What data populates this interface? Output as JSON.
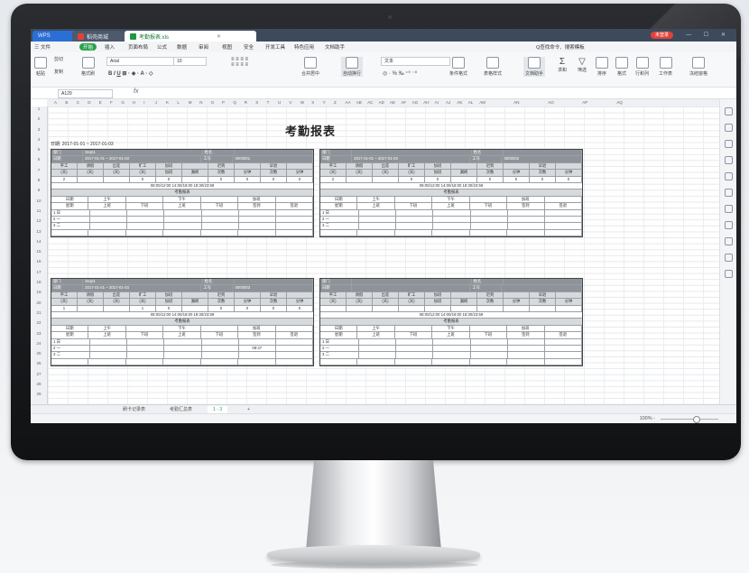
{
  "window": {
    "app_tab": "WPS",
    "home_tab": "稻壳商城",
    "file_tab": "考勤报表.xls",
    "login_label": "未登录",
    "controls": "— ☐ ✕"
  },
  "menu": [
    "三 文件",
    "开始",
    "插入",
    "页面布局",
    "公式",
    "数据",
    "审阅",
    "视图",
    "安全",
    "开发工具",
    "特色应用",
    "文档助手"
  ],
  "menu_active_index": 1,
  "menu_right": "Q查找命令、搜索模板",
  "toolbar": {
    "paste": "粘贴",
    "cut": "剪切",
    "copy": "复制",
    "format_painter": "格式刷",
    "font": "Arial",
    "size": "10",
    "format": "文本",
    "merge": "合并居中",
    "wrap": "自动换行",
    "cond_format": "条件格式",
    "table_style": "表格样式",
    "doc_helper": "文档助手",
    "sum": "求和",
    "filter": "筛选",
    "sort": "排序",
    "format_btn": "格式",
    "rowcol": "行和列",
    "sheet": "工作表",
    "freeze": "冻结窗格"
  },
  "namebox": "A129",
  "fx": "fx",
  "columns": [
    "A",
    "B",
    "C",
    "D",
    "E",
    "F",
    "G",
    "H",
    "I",
    "J",
    "K",
    "L",
    "M",
    "N",
    "O",
    "P",
    "Q",
    "R",
    "S",
    "T",
    "U",
    "V",
    "W",
    "X",
    "Y",
    "Z",
    "AA",
    "AB",
    "AC",
    "AD",
    "AE",
    "AF",
    "AG",
    "AH",
    "AI",
    "AJ",
    "AK",
    "AL",
    "AM",
    "AN",
    "AO",
    "AP",
    "AQ"
  ],
  "rows": [
    "1",
    "2",
    "3",
    "4",
    "5",
    "6",
    "7",
    "8",
    "9",
    "10",
    "11",
    "12",
    "13",
    "14",
    "15",
    "16",
    "17",
    "18",
    "19",
    "20",
    "21",
    "22",
    "23",
    "24",
    "25",
    "26",
    "27",
    "28",
    "29"
  ],
  "sheet": {
    "title": "考勤报表",
    "date_range": "日期: 2017-01-01 ~ 2017-01-03"
  },
  "cards": [
    {
      "dept": "Dept1",
      "date": "2017-01-01 ~ 2017-01-03",
      "id": "0000001",
      "work": "2",
      "r_v1": "0",
      "r_v2": "0",
      "times": "08:00/12:00 14:00/18:00 18:30/23:59",
      "section": "考勤报表",
      "days": [
        "1 日",
        "2 一",
        "3 二"
      ],
      "note": ""
    },
    {
      "dept": "",
      "date": "2017-01-01 ~ 2017-01-03",
      "id": "0000002",
      "work": "2",
      "r_v1": "0",
      "r_v2": "0",
      "times": "08:00/12:00 14:00/18:00 18:30/23:59",
      "section": "考勤报表",
      "days": [
        "1 日",
        "2 一",
        "3 二"
      ],
      "note": ""
    },
    {
      "dept": "Dept1",
      "date": "2017-01-01 ~ 2017-01-03",
      "id": "0000003",
      "work": "1",
      "r_v1": "1",
      "r_v2": "0",
      "times": "08:00/12:00 14:00/18:00 18:30/23:59",
      "section": "考勤报表",
      "days": [
        "1 日",
        "2 一",
        "3 二"
      ],
      "note": "08:47"
    },
    {
      "dept": "",
      "date": "",
      "id": "",
      "work": "",
      "r_v1": "",
      "r_v2": "",
      "times": "08:00/12:00 14:00/18:00 18:30/23:59",
      "section": "考勤报表",
      "days": [
        "1 日",
        "2 一",
        "3 二"
      ],
      "note": ""
    }
  ],
  "card_labels": {
    "dept": "部门",
    "date": "日期",
    "name": "姓名",
    "no": "工号",
    "cols": [
      "平工",
      "请假",
      "出差",
      "旷工",
      "加班",
      "",
      "迟到",
      "",
      "早退",
      ""
    ],
    "sub": [
      "(天)",
      "(天)",
      "(天)",
      "(天)",
      "加班",
      "漏刷",
      "次数",
      "分钟",
      "次数",
      "分钟"
    ],
    "period": [
      "日期",
      "上午",
      "",
      "下午",
      "",
      "加班",
      ""
    ],
    "week": [
      "星期",
      "上班",
      "下班",
      "上班",
      "下班",
      "签到",
      "签退"
    ]
  },
  "sheet_tabs": [
    "刷卡记录表",
    "考勤汇总表",
    "1 - 3"
  ],
  "sheet_tab_active": 2,
  "zoom": "100% -"
}
